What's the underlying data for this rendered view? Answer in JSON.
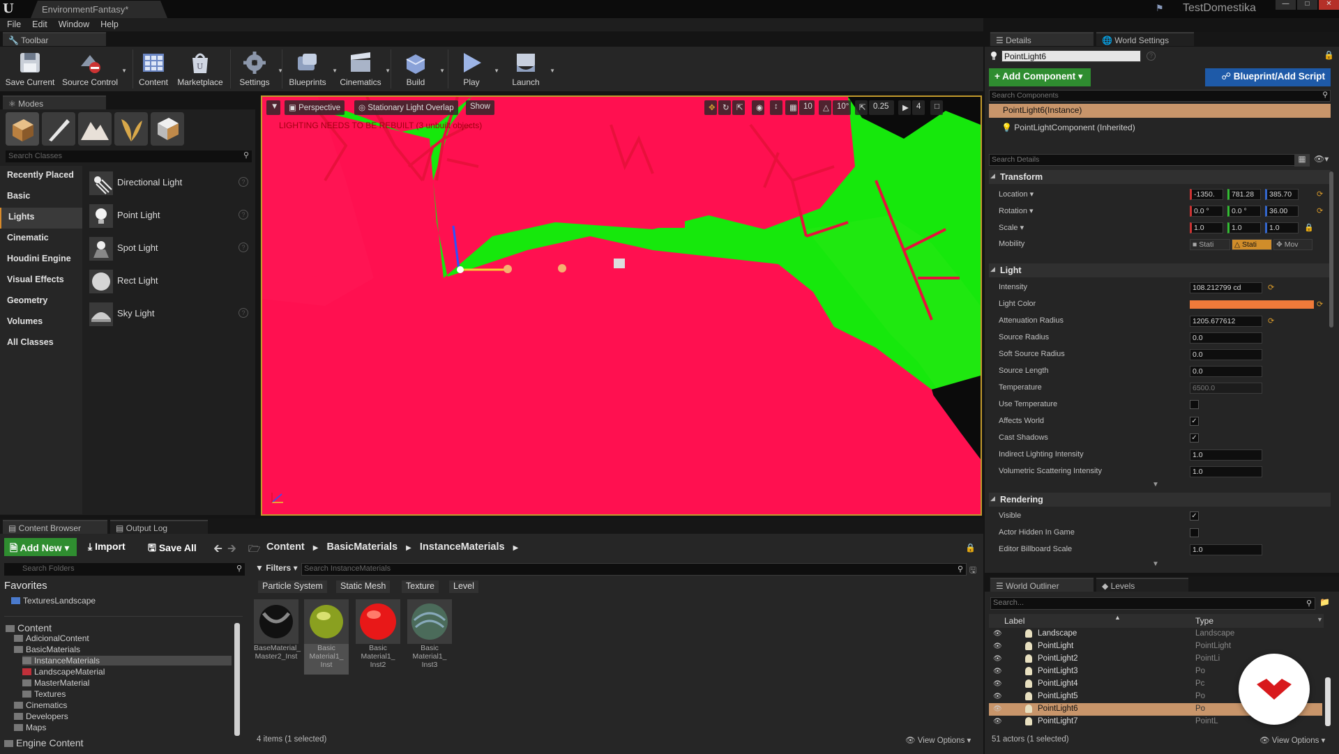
{
  "window": {
    "doc_tab": "EnvironmentFantasy*",
    "project": "TestDomestika"
  },
  "menu": [
    "File",
    "Edit",
    "Window",
    "Help"
  ],
  "toolbar": {
    "tab": "Toolbar",
    "buttons": [
      "Save Current",
      "Source Control",
      "Content",
      "Marketplace",
      "Settings",
      "Blueprints",
      "Cinematics",
      "Build",
      "Play",
      "Launch"
    ]
  },
  "modes": {
    "tab": "Modes",
    "search_placeholder": "Search Classes",
    "categories": [
      "Recently Placed",
      "Basic",
      "Lights",
      "Cinematic",
      "Houdini Engine",
      "Visual Effects",
      "Geometry",
      "Volumes",
      "All Classes"
    ],
    "items": [
      "Directional Light",
      "Point Light",
      "Spot Light",
      "Rect Light",
      "Sky Light"
    ]
  },
  "viewport": {
    "perspective": "Perspective",
    "view_mode": "Stationary Light Overlap",
    "show": "Show",
    "warning": "LIGHTING NEEDS TO BE REBUILT (3 unbuilt objects)",
    "grid": "10",
    "angle": "10°",
    "scale": "0.25",
    "cam": "4"
  },
  "details": {
    "tab": "Details",
    "tab2": "World Settings",
    "actor_name": "PointLight6",
    "add_component": "Add Component",
    "blueprint": "Blueprint/Add Script",
    "search_components": "Search Components",
    "components": [
      "PointLight6(Instance)",
      "PointLightComponent (Inherited)"
    ],
    "search_details": "Search Details",
    "transform": {
      "title": "Transform",
      "location_label": "Location",
      "location": [
        "-1350.",
        "781.28",
        "385.70"
      ],
      "rotation_label": "Rotation",
      "rotation": [
        "0.0 °",
        "0.0 °",
        "36.00"
      ],
      "scale_label": "Scale",
      "scale": [
        "1.0",
        "1.0",
        "1.0"
      ],
      "mobility_label": "Mobility",
      "mobility": [
        "Stati",
        "Stati",
        "Mov"
      ]
    },
    "light": {
      "title": "Light",
      "intensity_label": "Intensity",
      "intensity": "108.212799 cd",
      "color_label": "Light Color",
      "attenuation_label": "Attenuation Radius",
      "attenuation": "1205.677612",
      "source_radius_label": "Source Radius",
      "source_radius": "0.0",
      "soft_source_label": "Soft Source Radius",
      "soft_source": "0.0",
      "source_length_label": "Source Length",
      "source_length": "0.0",
      "temperature_label": "Temperature",
      "temperature": "6500.0",
      "use_temp_label": "Use Temperature",
      "affects_world_label": "Affects World",
      "cast_shadows_label": "Cast Shadows",
      "indirect_label": "Indirect Lighting Intensity",
      "indirect": "1.0",
      "volumetric_label": "Volumetric Scattering Intensity",
      "volumetric": "1.0"
    },
    "rendering": {
      "title": "Rendering",
      "visible_label": "Visible",
      "hidden_label": "Actor Hidden In Game",
      "billboard_label": "Editor Billboard Scale",
      "billboard": "1.0"
    },
    "colors": {
      "light_color": "#ef7a3a",
      "accent": "#d88a2a",
      "select": "#c8956a"
    }
  },
  "content_browser": {
    "tab": "Content Browser",
    "tab2": "Output Log",
    "add_new": "Add New",
    "import": "Import",
    "save_all": "Save All",
    "path": [
      "Content",
      "BasicMaterials",
      "InstanceMaterials"
    ],
    "search_folders": "Search Folders",
    "favorites": "Favorites",
    "fav_items": [
      "TexturesLandscape"
    ],
    "tree": [
      {
        "label": "Content",
        "level": 0
      },
      {
        "label": "AdicionalContent",
        "level": 1
      },
      {
        "label": "BasicMaterials",
        "level": 1
      },
      {
        "label": "InstanceMaterials",
        "level": 2
      },
      {
        "label": "LandscapeMaterial",
        "level": 2
      },
      {
        "label": "MasterMaterial",
        "level": 2
      },
      {
        "label": "Textures",
        "level": 2
      },
      {
        "label": "Cinematics",
        "level": 1
      },
      {
        "label": "Developers",
        "level": 1
      },
      {
        "label": "Maps",
        "level": 1
      },
      {
        "label": "Engine Content",
        "level": 0
      }
    ],
    "filters": "Filters",
    "search_assets": "Search InstanceMaterials",
    "chips": [
      "Particle System",
      "Static Mesh",
      "Texture",
      "Level"
    ],
    "assets": [
      "BaseMaterial_ Master2_Inst",
      "Basic Material1_ Inst",
      "Basic Material1_ Inst2",
      "Basic Material1_ Inst3"
    ],
    "status": "4 items (1 selected)",
    "view_options": "View Options"
  },
  "outliner": {
    "tab": "World Outliner",
    "tab2": "Levels",
    "search": "Search...",
    "col_label": "Label",
    "col_type": "Type",
    "rows": [
      {
        "name": "Landscape",
        "type": "Landscape"
      },
      {
        "name": "PointLight",
        "type": "PointLight"
      },
      {
        "name": "PointLight2",
        "type": "PointLi"
      },
      {
        "name": "PointLight3",
        "type": "Po"
      },
      {
        "name": "PointLight4",
        "type": "Pc"
      },
      {
        "name": "PointLight5",
        "type": "Po"
      },
      {
        "name": "PointLight6",
        "type": "Po"
      },
      {
        "name": "PointLight7",
        "type": "PointL"
      }
    ],
    "status": "51 actors (1 selected)",
    "view_options": "View Options"
  }
}
